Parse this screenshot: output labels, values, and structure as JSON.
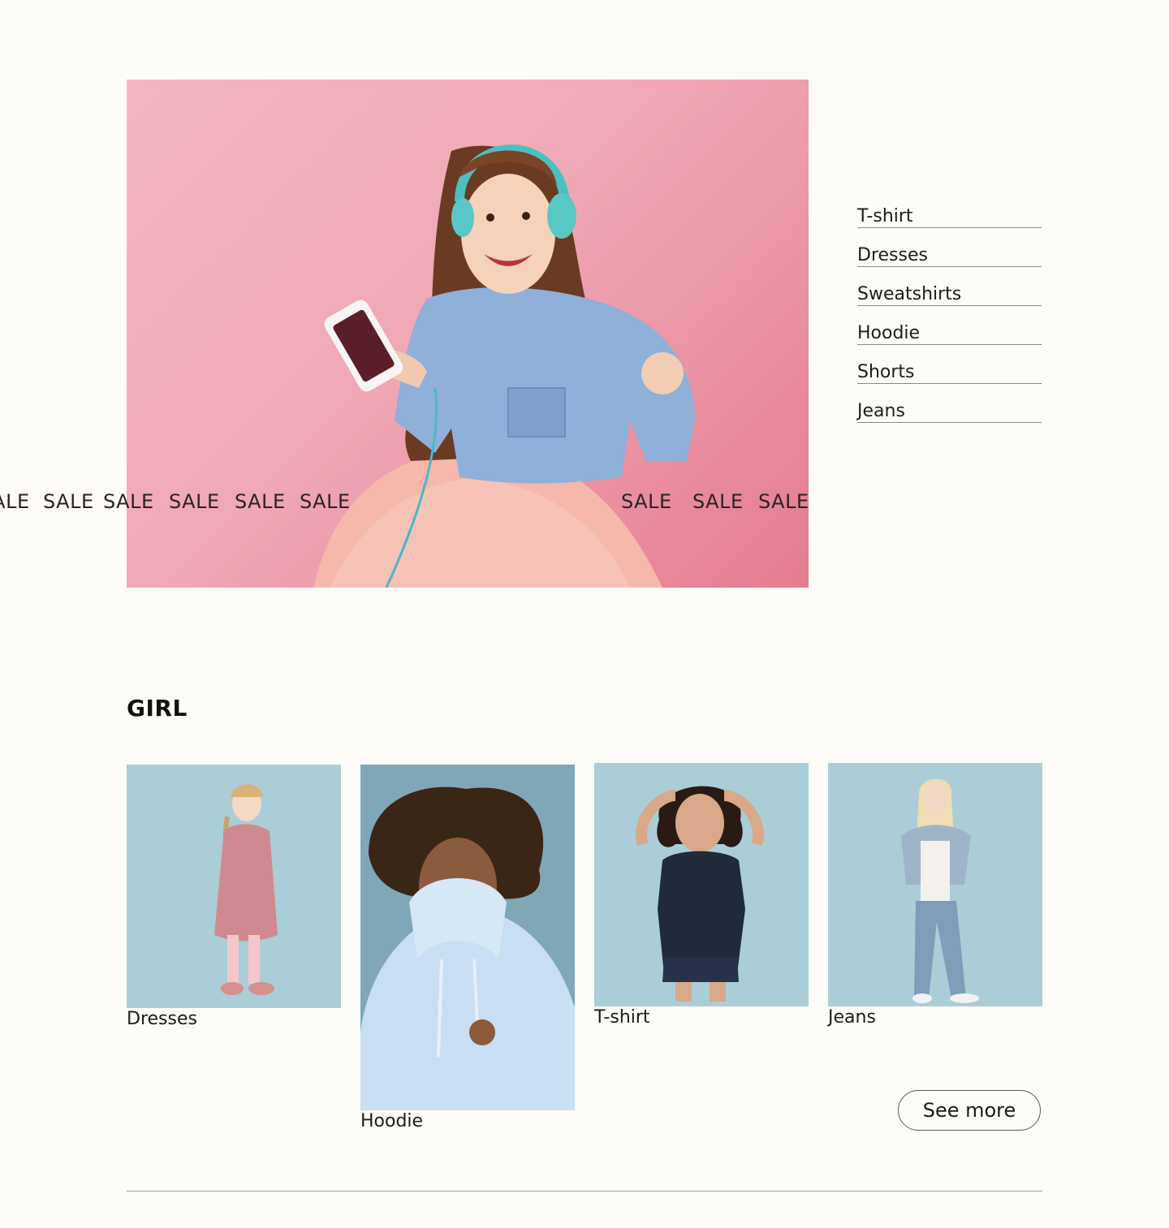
{
  "hero": {
    "sale_word": "SALE",
    "image_alt": "Smiling girl with turquoise headphones holding a phone, wearing a denim shirt and pink tulle skirt"
  },
  "categories": [
    "T-shirt",
    "Dresses",
    "Sweatshirts",
    "Hoodie",
    "Shorts",
    "Jeans"
  ],
  "girl_section": {
    "title": "GIRL",
    "cards": [
      {
        "label": "Dresses"
      },
      {
        "label": "Hoodie"
      },
      {
        "label": "T-shirt"
      },
      {
        "label": "Jeans"
      }
    ],
    "see_more": "See more"
  },
  "colors": {
    "page_bg": "#fdfcf8",
    "hero_pink": "#f0a8b6",
    "card_blue": "#abcdd8",
    "hoodie_blue": "#7fa7b8"
  }
}
